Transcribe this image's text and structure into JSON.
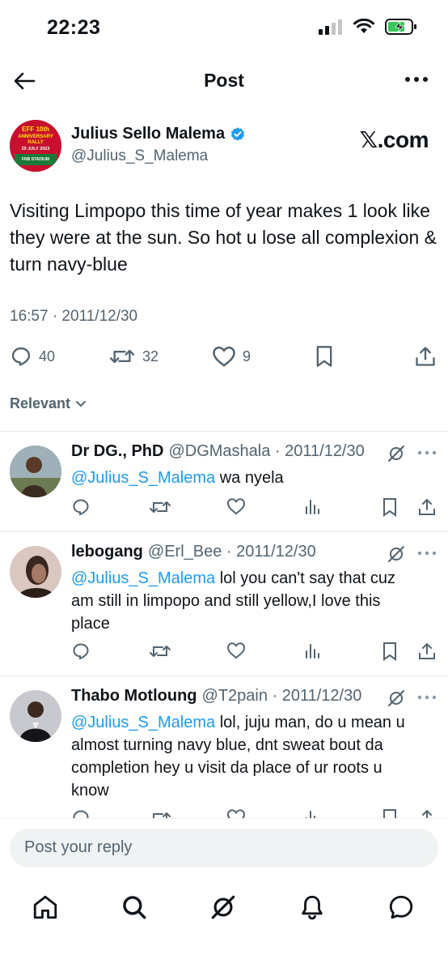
{
  "status_bar": {
    "time": "22:23"
  },
  "header": {
    "title": "Post"
  },
  "post": {
    "author_name": "Julius Sello Malema",
    "author_handle": "@Julius_S_Malema",
    "avatar_lines": [
      "EFF 10th",
      "ANNIVERSARY",
      "RALLY",
      "29 JULY 2023",
      "FNB STADIUM"
    ],
    "watermark": "𝕏.com",
    "text": "Visiting Limpopo this time of year makes 1 look like they were at the sun. So hot u lose all complexion & turn navy-blue",
    "timestamp": "16:57 · 2011/12/30",
    "replies_count": "40",
    "reposts_count": "32",
    "likes_count": "9"
  },
  "filter": {
    "label": "Relevant"
  },
  "replies": [
    {
      "name": "Dr DG., PhD",
      "meta": "@DGMashala · 2011/12/30",
      "mention": "@Julius_S_Malema",
      "text": " wa nyela"
    },
    {
      "name": "lebogang",
      "meta": "@Erl_Bee · 2011/12/30",
      "mention": "@Julius_S_Malema",
      "text": " lol you can't say that cuz am still in limpopo and still yellow,I love this place"
    },
    {
      "name": "Thabo Motloung",
      "meta": "@T2pain · 2011/12/30",
      "mention": "@Julius_S_Malema",
      "text": " lol, juju man, do u mean u almost turning navy blue, dnt sweat bout da completion hey u visit da place of ur roots u know"
    }
  ],
  "reply_box": {
    "placeholder": "Post your reply"
  },
  "colors": {
    "accent": "#1d9bf0",
    "muted": "#536471",
    "text": "#0f1419",
    "battery": "#34c759"
  },
  "icons": [
    "back-arrow-icon",
    "more-icon",
    "verified-icon",
    "reply-icon",
    "repost-icon",
    "like-icon",
    "bookmark-icon",
    "share-icon",
    "views-icon",
    "grok-icon",
    "home-icon",
    "search-icon",
    "notifications-icon",
    "messages-icon"
  ]
}
